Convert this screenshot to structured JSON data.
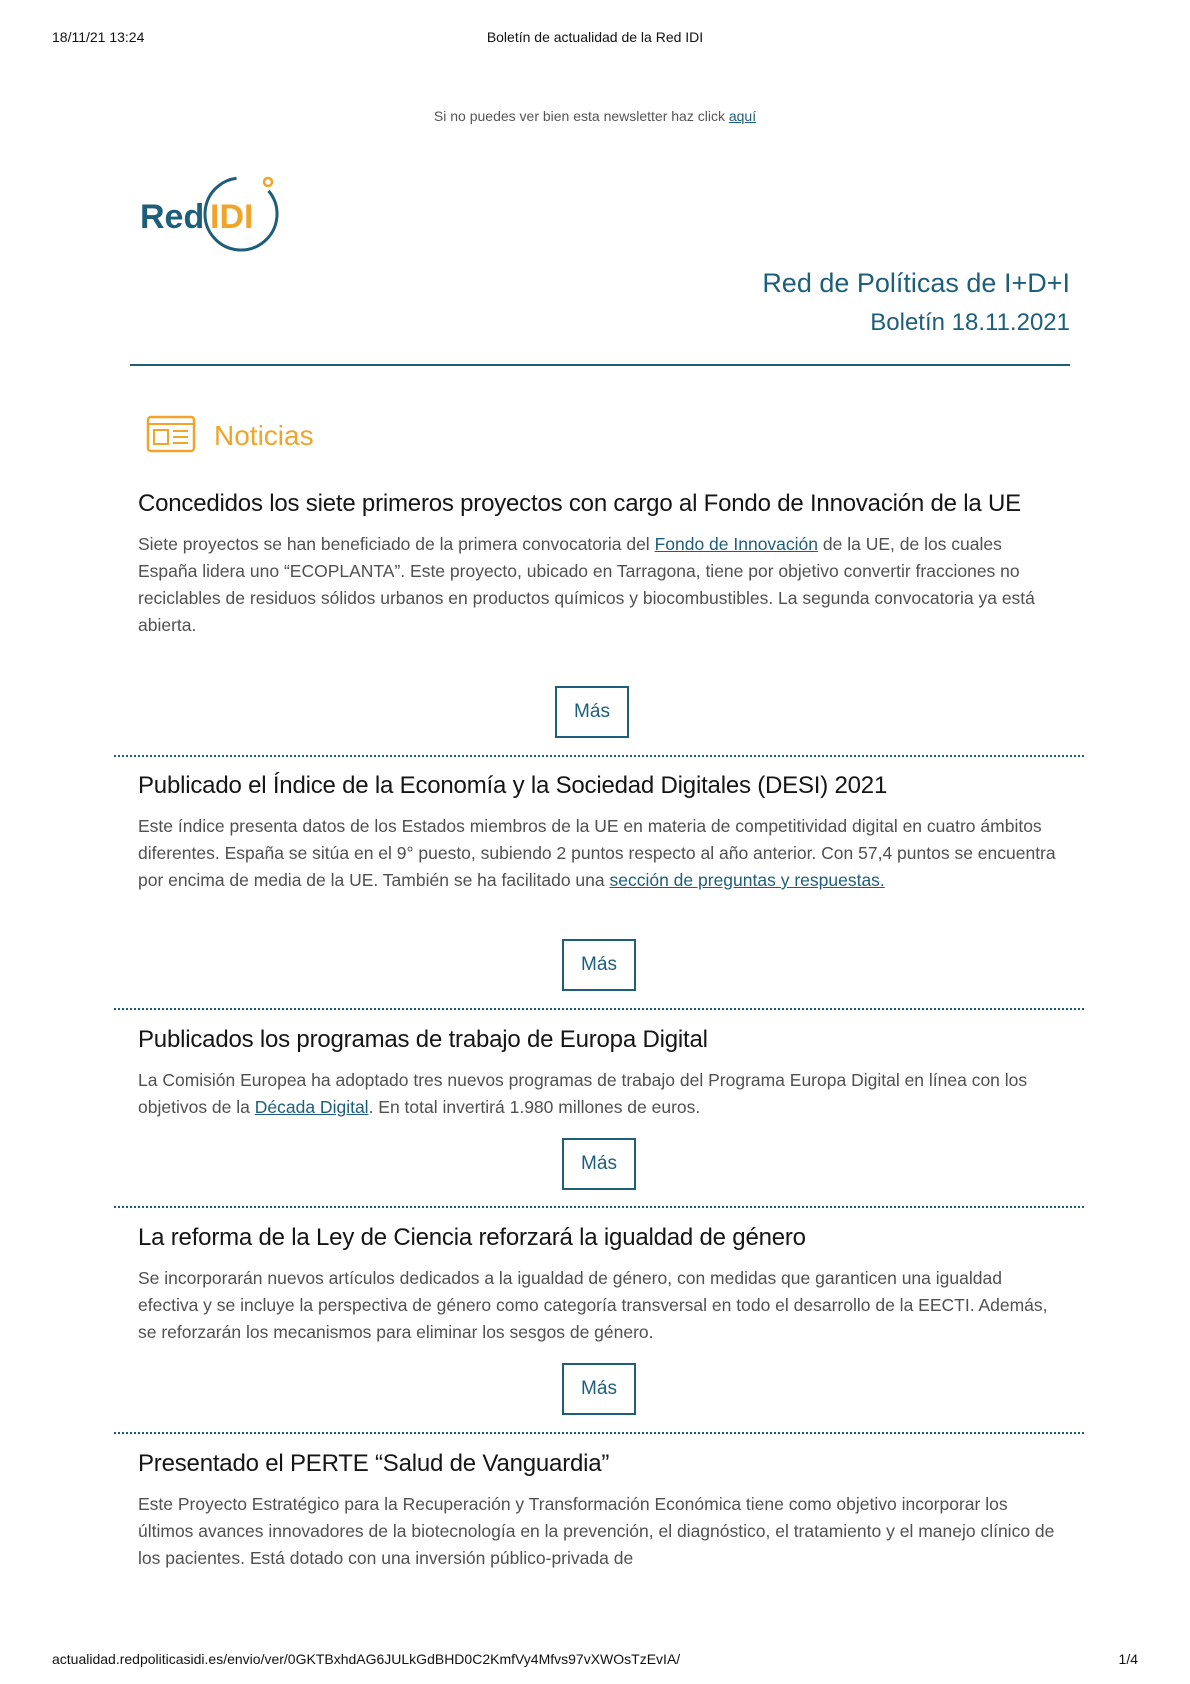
{
  "print": {
    "datetime": "18/11/21 13:24",
    "title": "Boletín de actualidad de la Red IDI",
    "url": "actualidad.redpoliticasidi.es/envio/ver/0GKTBxhdAG6JULkGdBHD0C2KmfVy4Mfvs97vXWOsTzEvIA/",
    "page": "1/4"
  },
  "preheader": {
    "text": "Si no puedes ver bien esta newsletter haz click",
    "link": "aquí"
  },
  "logo": {
    "red": "Red",
    "idi": "IDI"
  },
  "brand": {
    "network": "Red de Políticas de I+D+I",
    "issue": "Boletín 18.11.2021"
  },
  "section": {
    "label": "Noticias",
    "icon": "newspaper-icon"
  },
  "articles": [
    {
      "title": "Concedidos los siete primeros proyectos con cargo al Fondo de Innovación de la UE",
      "body_before": "Siete proyectos se han beneficiado de la primera convocatoria del ",
      "link": "Fondo de Innovación",
      "body_after": " de la UE, de los cuales España lidera uno “ECOPLANTA”. Este proyecto, ubicado en Tarragona, tiene por objetivo convertir fracciones no reciclables de residuos sólidos urbanos en productos químicos y biocombustibles. La segunda convocatoria ya está abierta.",
      "more": "Más"
    },
    {
      "title": "Publicado el Índice de la Economía y la Sociedad Digitales (DESI) 2021",
      "body_before": "Este índice presenta datos de los Estados miembros de la UE en materia de competitividad digital en cuatro ámbitos diferentes. España se sitúa en el 9° puesto, subiendo 2 puntos respecto al año anterior. Con 57,4 puntos se encuentra por encima de media de la UE. También se ha facilitado una ",
      "link": "sección de preguntas y respuestas.",
      "body_after": "",
      "more": "Más"
    },
    {
      "title": "Publicados los programas de trabajo de Europa Digital",
      "body_before": "La Comisión Europea ha adoptado tres nuevos programas de trabajo del Programa Europa Digital en línea con los objetivos de la ",
      "link": "Década Digital",
      "body_after": ". En total invertirá 1.980 millones de euros.",
      "more": "Más"
    },
    {
      "title": "La reforma de la Ley de Ciencia reforzará la igualdad de género",
      "body_before": "Se incorporarán nuevos artículos dedicados a la igualdad de género, con medidas que garanticen una igualdad efectiva y se incluye la perspectiva de género como categoría transversal en todo el desarrollo de la EECTI. Además, se reforzarán los mecanismos para eliminar los sesgos de género.",
      "link": "",
      "body_after": "",
      "more": "Más"
    },
    {
      "title": "Presentado el PERTE “Salud de Vanguardia”",
      "body_before": "Este Proyecto Estratégico para la Recuperación y Transformación Económica tiene como objetivo incorporar los últimos avances innovadores de la biotecnología en la prevención, el diagnóstico, el tratamiento y el manejo clínico de los pacientes. Está dotado con una inversión público-privada de",
      "link": "",
      "body_after": ""
    }
  ],
  "colors": {
    "brand_blue": "#1d5f7a",
    "accent_orange": "#f0a52a"
  }
}
